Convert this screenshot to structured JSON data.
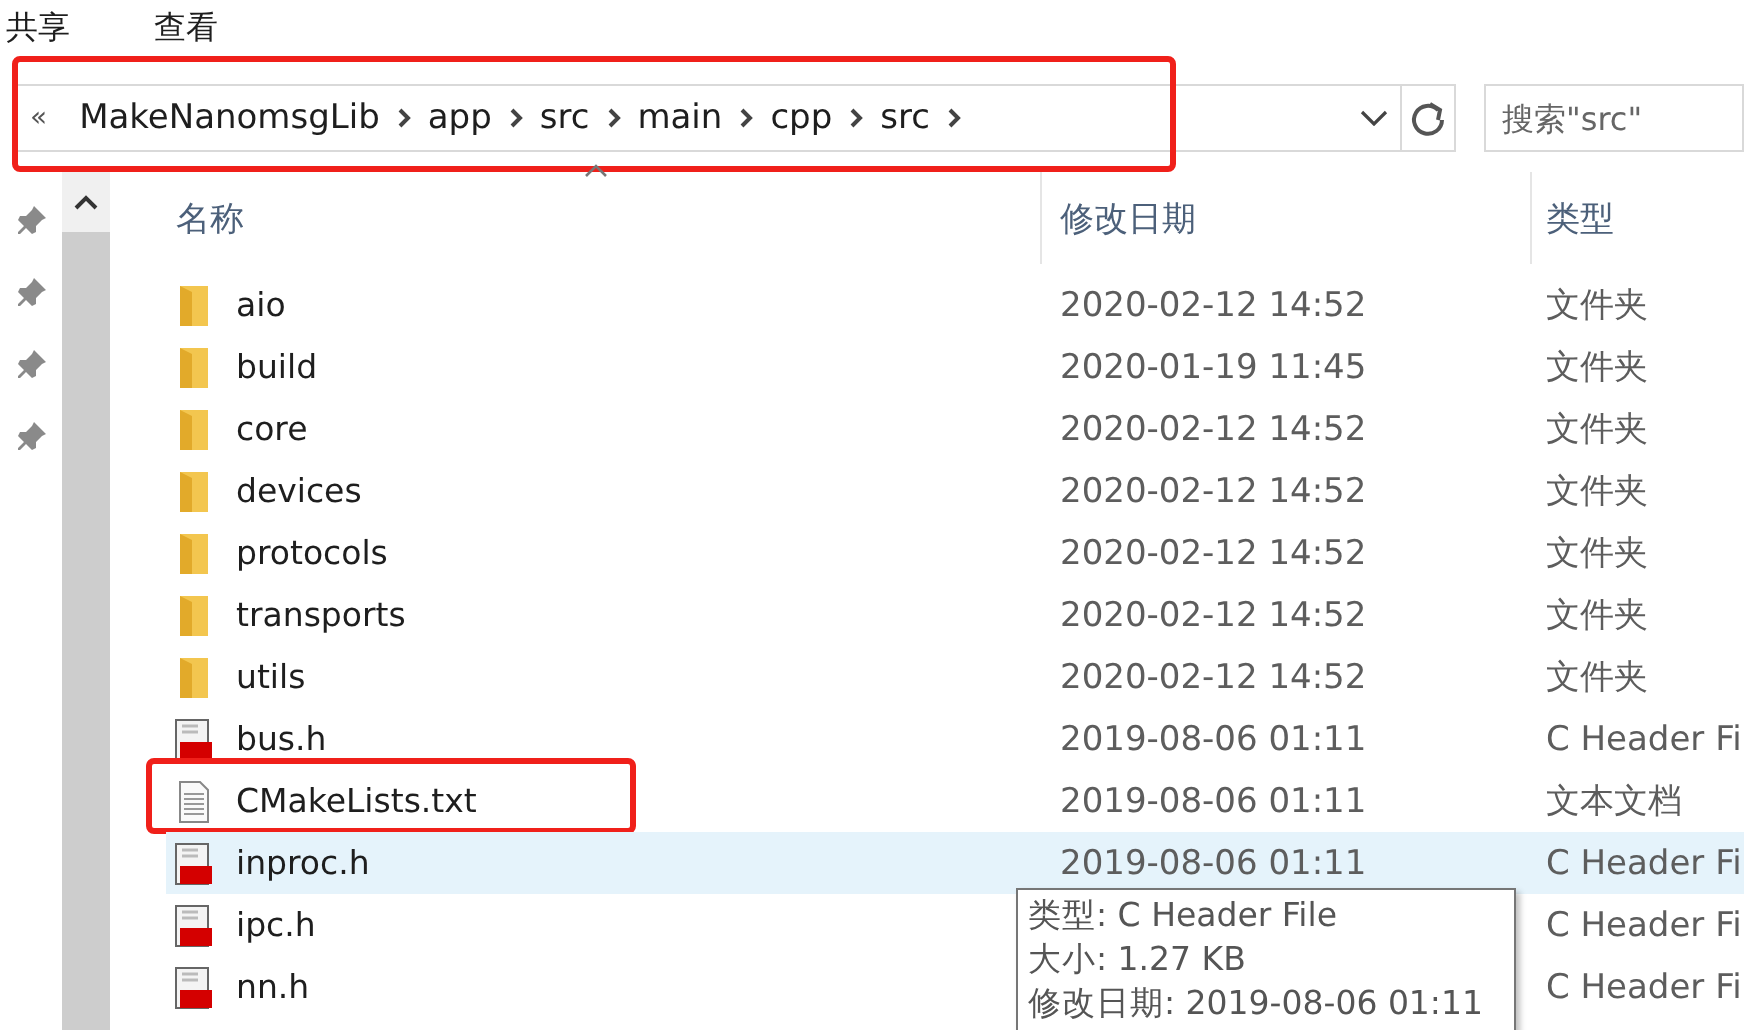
{
  "menu": [
    "共享",
    "查看"
  ],
  "address": {
    "overflow": "«",
    "crumbs": [
      "MakeNanomsgLib",
      "app",
      "src",
      "main",
      "cpp",
      "src"
    ]
  },
  "search": {
    "placeholder": "搜索\"src\""
  },
  "columns": [
    "名称",
    "修改日期",
    "类型"
  ],
  "rows": [
    {
      "kind": "folder",
      "name": "aio",
      "date": "2020-02-12 14:52",
      "type": "文件夹",
      "hovered": false,
      "annotated": false
    },
    {
      "kind": "folder",
      "name": "build",
      "date": "2020-01-19 11:45",
      "type": "文件夹",
      "hovered": false,
      "annotated": false
    },
    {
      "kind": "folder",
      "name": "core",
      "date": "2020-02-12 14:52",
      "type": "文件夹",
      "hovered": false,
      "annotated": false
    },
    {
      "kind": "folder",
      "name": "devices",
      "date": "2020-02-12 14:52",
      "type": "文件夹",
      "hovered": false,
      "annotated": false
    },
    {
      "kind": "folder",
      "name": "protocols",
      "date": "2020-02-12 14:52",
      "type": "文件夹",
      "hovered": false,
      "annotated": false
    },
    {
      "kind": "folder",
      "name": "transports",
      "date": "2020-02-12 14:52",
      "type": "文件夹",
      "hovered": false,
      "annotated": false
    },
    {
      "kind": "folder",
      "name": "utils",
      "date": "2020-02-12 14:52",
      "type": "文件夹",
      "hovered": false,
      "annotated": false
    },
    {
      "kind": "header",
      "name": "bus.h",
      "date": "2019-08-06 01:11",
      "type": "C Header Fi",
      "hovered": false,
      "annotated": false
    },
    {
      "kind": "text",
      "name": "CMakeLists.txt",
      "date": "2019-08-06 01:11",
      "type": "文本文档",
      "hovered": false,
      "annotated": true
    },
    {
      "kind": "header",
      "name": "inproc.h",
      "date": "2019-08-06 01:11",
      "type": "C Header Fi",
      "hovered": true,
      "annotated": false
    },
    {
      "kind": "header",
      "name": "ipc.h",
      "type": "C Header Fi",
      "hovered": false,
      "annotated": false
    },
    {
      "kind": "header",
      "name": "nn.h",
      "type": "C Header Fi",
      "hovered": false,
      "annotated": false
    }
  ],
  "tooltip": [
    "类型: C Header File",
    "大小: 1.27 KB",
    "修改日期: 2019-08-06 01:11"
  ]
}
